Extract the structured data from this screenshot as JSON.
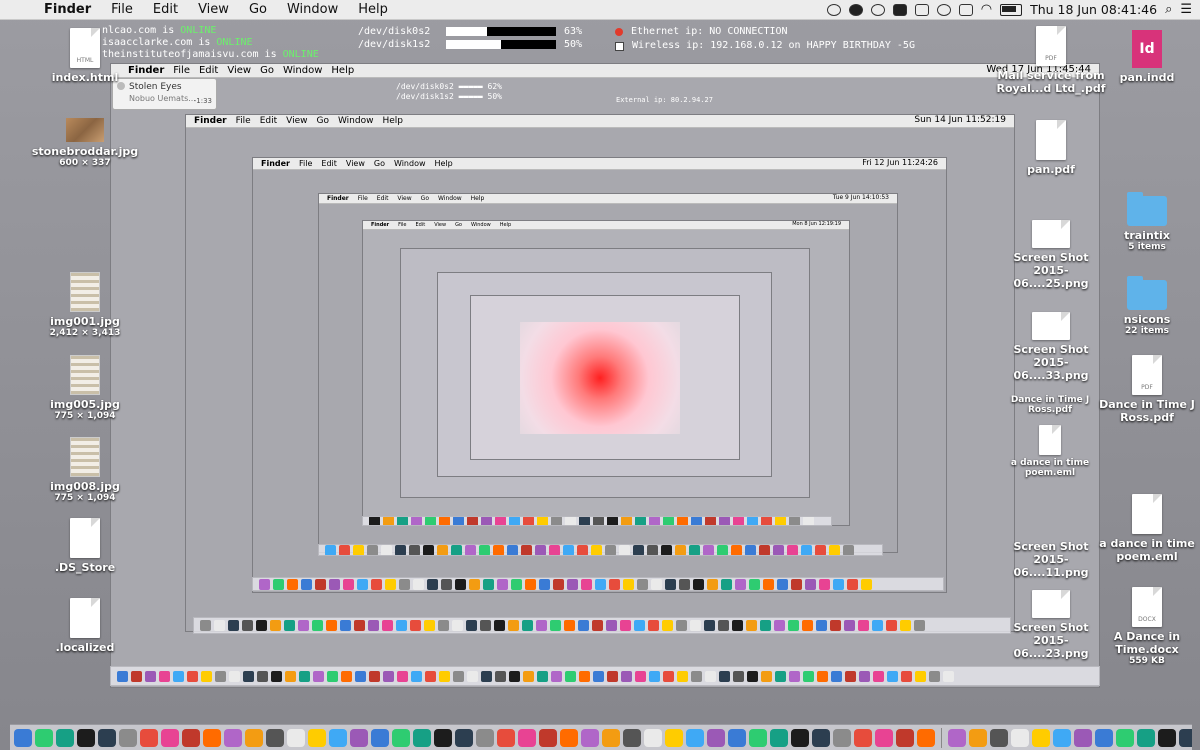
{
  "menubar": {
    "apple_glyph": "",
    "app_name": "Finder",
    "menus": [
      "File",
      "Edit",
      "View",
      "Go",
      "Window",
      "Help"
    ],
    "clock": "Thu 18 Jun  08:41:46"
  },
  "status": {
    "hosts": [
      {
        "host": "nlcao.com is ",
        "state": "ONLINE"
      },
      {
        "host": "isaacclarke.com is ",
        "state": "ONLINE"
      },
      {
        "host": "theinstituteofjamaisvu.com is ",
        "state": "ONLINE"
      }
    ],
    "disks": [
      {
        "name": "/dev/disk0s2",
        "percent_label": "63%",
        "used_fraction": 0.63
      },
      {
        "name": "/dev/disk1s2",
        "percent_label": "50%",
        "used_fraction": 0.5
      }
    ],
    "network": {
      "ethernet": "Ethernet ip: NO CONNECTION",
      "wireless": "Wireless ip: 192.168.0.12 on HAPPY BIRTHDAY -5G"
    }
  },
  "nested_clocks": [
    "Wed 17 Jun  11:45:44",
    "Sun 14 Jun  11:52:19",
    "Fri 12 Jun  11:24:26",
    "Tue 9 Jun  14:10:53",
    "Mon 8 Jun  12:19:19"
  ],
  "nested_status": {
    "hosts_partial": [
      "on is ONLINE",
      "larke.com is ONLINE",
      "ituteofjamaisvu.com is ONLINE"
    ],
    "disk0": "62%",
    "disk1": "50%",
    "external": "External ip: 80.2.94.27"
  },
  "player": {
    "title": "Stolen Eyes",
    "artist": "Nobuo Uemats...",
    "time": "-1:33"
  },
  "desktop_left": [
    {
      "label": "index.html",
      "kind": "doc",
      "tag": "HTML"
    },
    {
      "label": "stonebroddar.jpg",
      "sub": "600 × 337",
      "kind": "photo"
    },
    {
      "label": "img001.jpg",
      "sub": "2,412 × 3,413",
      "kind": "scan"
    },
    {
      "label": "img005.jpg",
      "sub": "775 × 1,094",
      "kind": "scan"
    },
    {
      "label": "img008.jpg",
      "sub": "775 × 1,094",
      "kind": "scan"
    },
    {
      "label": ".DS_Store",
      "kind": "doc"
    },
    {
      "label": ".localized",
      "kind": "doc"
    }
  ],
  "desktop_right": [
    {
      "label": "pan.indd",
      "kind": "indd",
      "glyph": "Id",
      "tag": "INDD"
    },
    {
      "label": "traintix",
      "sub": "5 items",
      "kind": "folder"
    },
    {
      "label": "nsicons",
      "sub": "22 items",
      "kind": "folder"
    },
    {
      "label": "Dance in Time J Ross.pdf",
      "kind": "doc",
      "tag": "PDF"
    },
    {
      "label": "a dance in time poem.eml",
      "kind": "doc"
    },
    {
      "label": "A Dance in Time.docx",
      "sub": "559 KB",
      "kind": "doc",
      "tag": "DOCX"
    }
  ],
  "desktop_mid": [
    {
      "label": "Mail service from Royal...d Ltd_.pdf",
      "kind": "doc",
      "tag": "PDF"
    },
    {
      "label": "pan.pdf",
      "kind": "doc"
    },
    {
      "label": "Screen Shot 2015-06....25.png",
      "kind": "shot"
    },
    {
      "label": "Screen Shot 2015-06....33.png",
      "kind": "shot"
    },
    {
      "label": "Dance in Time J Ross.pdf",
      "kind": "doc"
    },
    {
      "label": "a dance in time poem.eml",
      "kind": "doc"
    },
    {
      "label": "Screen Shot 2015-06....11.png",
      "kind": "shot"
    },
    {
      "label": "Screen Shot 2015-06....23.png",
      "kind": "shot"
    }
  ],
  "colors": {
    "online": "#6cf06c",
    "desktop": "#8f8f94",
    "folder": "#5fb3ea",
    "indesign": "#d8337a"
  }
}
